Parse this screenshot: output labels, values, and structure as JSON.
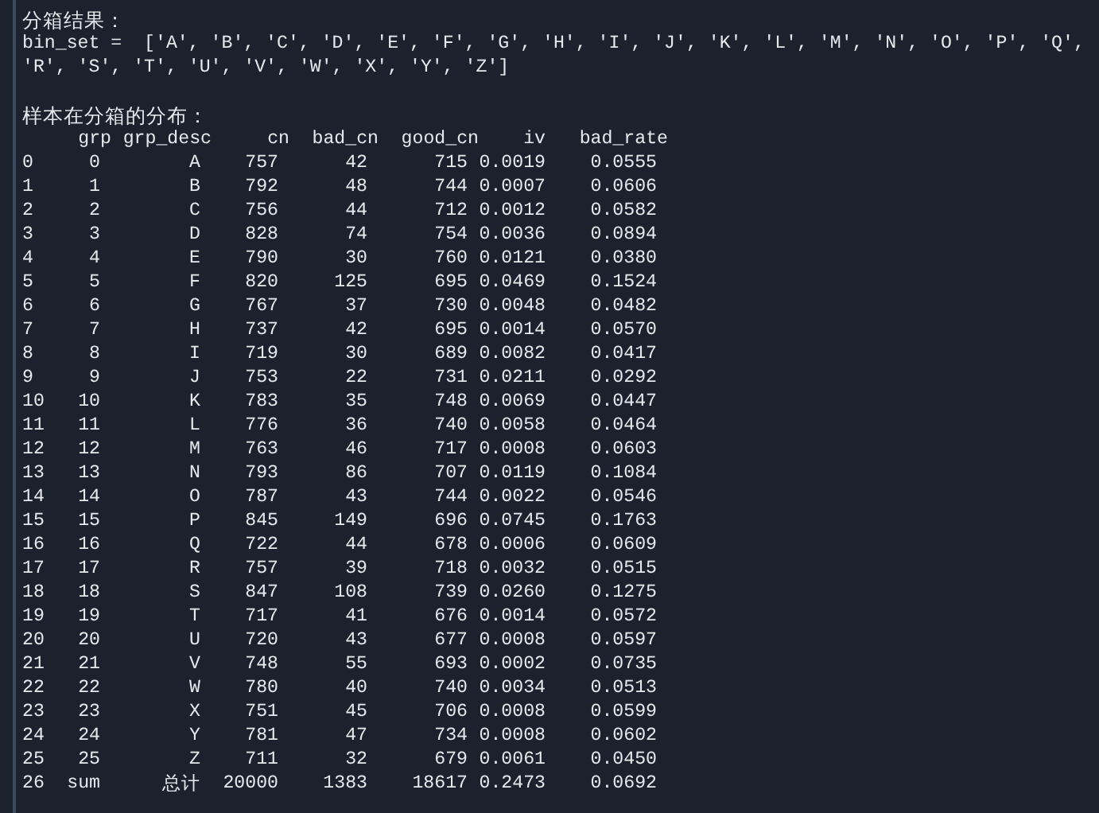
{
  "console": {
    "title": "分箱结果：",
    "bin_set_lines": [
      "bin_set =  ['A', 'B', 'C', 'D', 'E', 'F', 'G', 'H', 'I', 'J', 'K', 'L', 'M', 'N', 'O', 'P', 'Q',",
      "'R', 'S', 'T', 'U', 'V', 'W', 'X', 'Y', 'Z']"
    ],
    "table_title": "样本在分箱的分布：",
    "table": {
      "columns": [
        "",
        "grp",
        "grp_desc",
        "cn",
        "bad_cn",
        "good_cn",
        "iv",
        "bad_rate"
      ],
      "rows": [
        [
          "0",
          "0",
          "A",
          "757",
          "42",
          "715",
          "0.0019",
          "0.0555"
        ],
        [
          "1",
          "1",
          "B",
          "792",
          "48",
          "744",
          "0.0007",
          "0.0606"
        ],
        [
          "2",
          "2",
          "C",
          "756",
          "44",
          "712",
          "0.0012",
          "0.0582"
        ],
        [
          "3",
          "3",
          "D",
          "828",
          "74",
          "754",
          "0.0036",
          "0.0894"
        ],
        [
          "4",
          "4",
          "E",
          "790",
          "30",
          "760",
          "0.0121",
          "0.0380"
        ],
        [
          "5",
          "5",
          "F",
          "820",
          "125",
          "695",
          "0.0469",
          "0.1524"
        ],
        [
          "6",
          "6",
          "G",
          "767",
          "37",
          "730",
          "0.0048",
          "0.0482"
        ],
        [
          "7",
          "7",
          "H",
          "737",
          "42",
          "695",
          "0.0014",
          "0.0570"
        ],
        [
          "8",
          "8",
          "I",
          "719",
          "30",
          "689",
          "0.0082",
          "0.0417"
        ],
        [
          "9",
          "9",
          "J",
          "753",
          "22",
          "731",
          "0.0211",
          "0.0292"
        ],
        [
          "10",
          "10",
          "K",
          "783",
          "35",
          "748",
          "0.0069",
          "0.0447"
        ],
        [
          "11",
          "11",
          "L",
          "776",
          "36",
          "740",
          "0.0058",
          "0.0464"
        ],
        [
          "12",
          "12",
          "M",
          "763",
          "46",
          "717",
          "0.0008",
          "0.0603"
        ],
        [
          "13",
          "13",
          "N",
          "793",
          "86",
          "707",
          "0.0119",
          "0.1084"
        ],
        [
          "14",
          "14",
          "O",
          "787",
          "43",
          "744",
          "0.0022",
          "0.0546"
        ],
        [
          "15",
          "15",
          "P",
          "845",
          "149",
          "696",
          "0.0745",
          "0.1763"
        ],
        [
          "16",
          "16",
          "Q",
          "722",
          "44",
          "678",
          "0.0006",
          "0.0609"
        ],
        [
          "17",
          "17",
          "R",
          "757",
          "39",
          "718",
          "0.0032",
          "0.0515"
        ],
        [
          "18",
          "18",
          "S",
          "847",
          "108",
          "739",
          "0.0260",
          "0.1275"
        ],
        [
          "19",
          "19",
          "T",
          "717",
          "41",
          "676",
          "0.0014",
          "0.0572"
        ],
        [
          "20",
          "20",
          "U",
          "720",
          "43",
          "677",
          "0.0008",
          "0.0597"
        ],
        [
          "21",
          "21",
          "V",
          "748",
          "55",
          "693",
          "0.0002",
          "0.0735"
        ],
        [
          "22",
          "22",
          "W",
          "780",
          "40",
          "740",
          "0.0034",
          "0.0513"
        ],
        [
          "23",
          "23",
          "X",
          "751",
          "45",
          "706",
          "0.0008",
          "0.0599"
        ],
        [
          "24",
          "24",
          "Y",
          "781",
          "47",
          "734",
          "0.0008",
          "0.0602"
        ],
        [
          "25",
          "25",
          "Z",
          "711",
          "32",
          "679",
          "0.0061",
          "0.0450"
        ],
        [
          "26",
          "sum",
          "总计",
          "20000",
          "1383",
          "18617",
          "0.2473",
          "0.0692"
        ]
      ]
    }
  }
}
